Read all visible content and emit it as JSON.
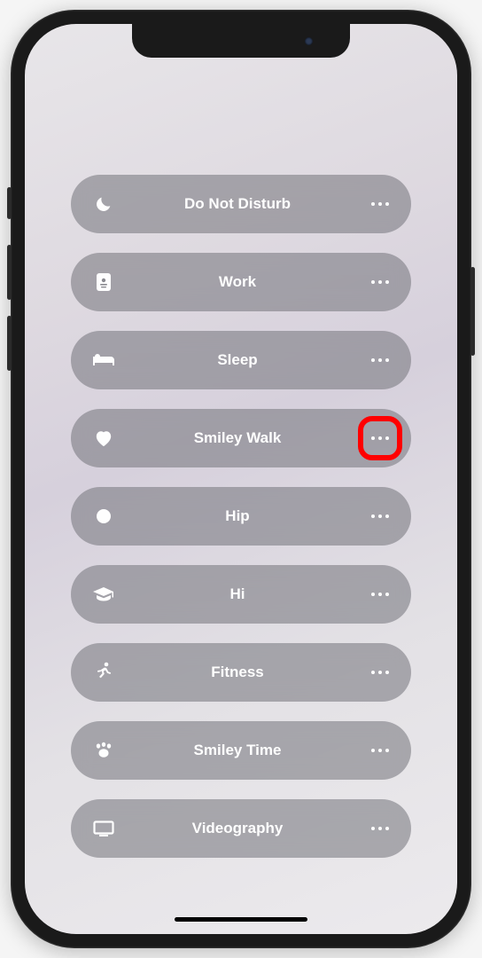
{
  "focus": {
    "items": [
      {
        "icon": "moon",
        "label": "Do Not Disturb",
        "highlight": false
      },
      {
        "icon": "badge",
        "label": "Work",
        "highlight": false
      },
      {
        "icon": "bed",
        "label": "Sleep",
        "highlight": false
      },
      {
        "icon": "heart",
        "label": "Smiley Walk",
        "highlight": true
      },
      {
        "icon": "circle",
        "label": "Hip",
        "highlight": false
      },
      {
        "icon": "gradcap",
        "label": "Hi",
        "highlight": false
      },
      {
        "icon": "runner",
        "label": "Fitness",
        "highlight": false
      },
      {
        "icon": "paw",
        "label": "Smiley Time",
        "highlight": false
      },
      {
        "icon": "display",
        "label": "Videography",
        "highlight": false
      }
    ]
  },
  "highlight_color": "#ff0000"
}
